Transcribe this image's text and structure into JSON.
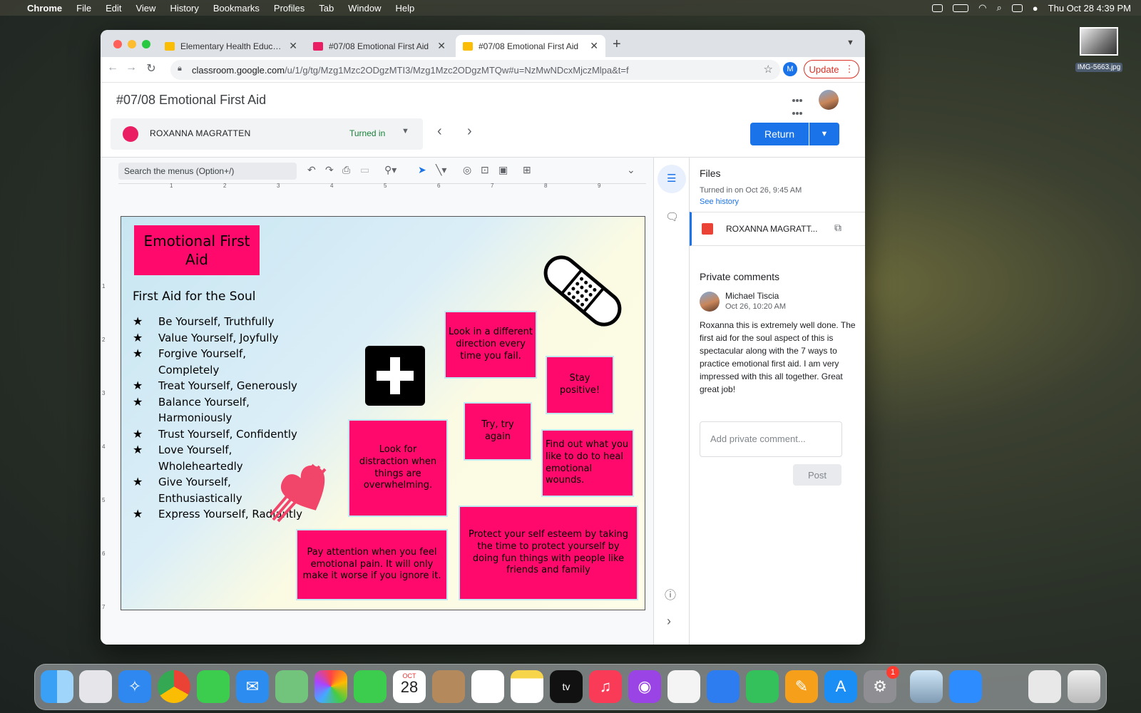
{
  "menubar": {
    "app": "Chrome",
    "items": [
      "File",
      "Edit",
      "View",
      "History",
      "Bookmarks",
      "Profiles",
      "Tab",
      "Window",
      "Help"
    ],
    "datetime": "Thu Oct 28  4:39 PM"
  },
  "desktop": {
    "file_label": "IMG-5663.jpg"
  },
  "browser": {
    "tabs": [
      {
        "title": "Elementary Health Education (",
        "favicon_color": "#fbbc04"
      },
      {
        "title": "#07/08 Emotional First Aid",
        "favicon_color": "#e91e63"
      },
      {
        "title": "#07/08 Emotional First Aid",
        "favicon_color": "#fbbc04"
      }
    ],
    "url_host": "classroom.google.com",
    "url_path": "/u/1/g/tg/Mzg1Mzc2ODgzMTI3/Mzg1Mzc2ODgzMTQw#u=NzMwNDcxMjczMlpa&t=f",
    "profile_letter": "M",
    "update_label": "Update"
  },
  "classroom": {
    "title": "#07/08 Emotional First Aid",
    "student_name": "ROXANNA MAGRATTEN",
    "status": "Turned in",
    "return_label": "Return"
  },
  "drawing": {
    "menu_search": "Search the menus (Option+/)",
    "ruler": [
      "1",
      "2",
      "3",
      "4",
      "5",
      "6",
      "7",
      "8",
      "9"
    ],
    "vruler": [
      "1",
      "2",
      "3",
      "4",
      "5",
      "6",
      "7"
    ],
    "title": "Emotional First Aid",
    "subtitle": "First Aid for the Soul",
    "list": [
      "Be Yourself, Truthfully",
      "Value Yourself, Joyfully",
      "Forgive Yourself, Completely",
      "Treat Yourself, Generously",
      "Balance Yourself, Harmoniously",
      "Trust Yourself, Confidently",
      "Love Yourself, Wholeheartedly",
      "Give Yourself, Enthusiastically",
      "Express Yourself, Radiantly"
    ],
    "tips": {
      "look_different": "Look in a different direction every time you fail.",
      "stay_positive": "Stay positive!",
      "try_again": "Try, try again",
      "distraction": "Look for distraction when things are overwhelming.",
      "find_out": "Find out what you like to do to heal emotional wounds.",
      "pay_attention": "Pay attention when you feel emotional pain. It will only make it worse if you ignore it.",
      "protect": "Protect your self esteem by taking the time to protect yourself by doing fun things with people like friends and family"
    },
    "accent_color": "#ff0a6c"
  },
  "side_panel": {
    "files_heading": "Files",
    "turned_in_on": "Turned in on Oct 26, 9:45 AM",
    "see_history": "See history",
    "file_name": "ROXANNA MAGRATT...",
    "private_comments_heading": "Private comments",
    "comment_author": "Michael Tiscia",
    "comment_date": "Oct 26, 10:20 AM",
    "comment_text": "Roxanna this is extremely well done. The first aid for the soul aspect of this is spectacular along with the 7 ways to practice emotional first aid. I am very impressed with this all together. Great great job!",
    "comment_placeholder": "Add private comment...",
    "post_label": "Post"
  },
  "dock": {
    "calendar_month": "OCT",
    "calendar_day": "28",
    "settings_badge": "1",
    "icons": [
      "finder-icon",
      "launchpad-icon",
      "safari-icon",
      "chrome-icon",
      "messages-icon",
      "mail-icon",
      "maps-icon",
      "photos-icon",
      "facetime-icon",
      "calendar-icon",
      "contacts-icon",
      "reminders-icon",
      "notes-icon",
      "appletv-icon",
      "music-icon",
      "podcasts-icon",
      "news-icon",
      "keynote-icon",
      "numbers-icon",
      "pages-icon",
      "appstore-icon",
      "settings-icon",
      "preview-icon",
      "zoom-icon",
      "documents-icon",
      "trash-icon"
    ]
  }
}
